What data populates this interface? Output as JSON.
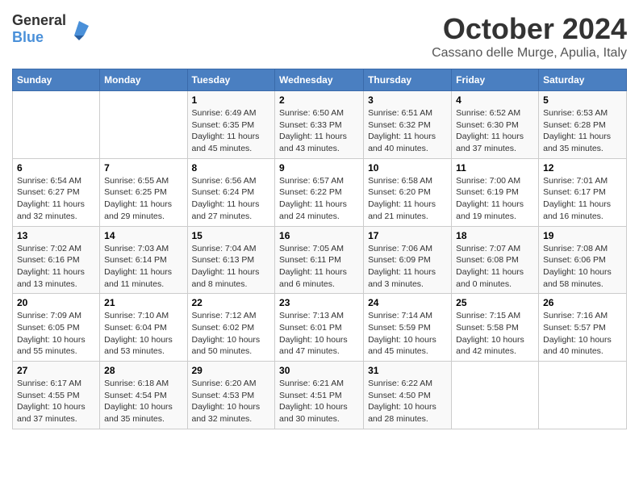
{
  "header": {
    "logo": {
      "text_general": "General",
      "text_blue": "Blue"
    },
    "month": "October 2024",
    "location": "Cassano delle Murge, Apulia, Italy"
  },
  "days_of_week": [
    "Sunday",
    "Monday",
    "Tuesday",
    "Wednesday",
    "Thursday",
    "Friday",
    "Saturday"
  ],
  "weeks": [
    [
      {
        "day": "",
        "info": ""
      },
      {
        "day": "",
        "info": ""
      },
      {
        "day": "1",
        "info": "Sunrise: 6:49 AM\nSunset: 6:35 PM\nDaylight: 11 hours and 45 minutes."
      },
      {
        "day": "2",
        "info": "Sunrise: 6:50 AM\nSunset: 6:33 PM\nDaylight: 11 hours and 43 minutes."
      },
      {
        "day": "3",
        "info": "Sunrise: 6:51 AM\nSunset: 6:32 PM\nDaylight: 11 hours and 40 minutes."
      },
      {
        "day": "4",
        "info": "Sunrise: 6:52 AM\nSunset: 6:30 PM\nDaylight: 11 hours and 37 minutes."
      },
      {
        "day": "5",
        "info": "Sunrise: 6:53 AM\nSunset: 6:28 PM\nDaylight: 11 hours and 35 minutes."
      }
    ],
    [
      {
        "day": "6",
        "info": "Sunrise: 6:54 AM\nSunset: 6:27 PM\nDaylight: 11 hours and 32 minutes."
      },
      {
        "day": "7",
        "info": "Sunrise: 6:55 AM\nSunset: 6:25 PM\nDaylight: 11 hours and 29 minutes."
      },
      {
        "day": "8",
        "info": "Sunrise: 6:56 AM\nSunset: 6:24 PM\nDaylight: 11 hours and 27 minutes."
      },
      {
        "day": "9",
        "info": "Sunrise: 6:57 AM\nSunset: 6:22 PM\nDaylight: 11 hours and 24 minutes."
      },
      {
        "day": "10",
        "info": "Sunrise: 6:58 AM\nSunset: 6:20 PM\nDaylight: 11 hours and 21 minutes."
      },
      {
        "day": "11",
        "info": "Sunrise: 7:00 AM\nSunset: 6:19 PM\nDaylight: 11 hours and 19 minutes."
      },
      {
        "day": "12",
        "info": "Sunrise: 7:01 AM\nSunset: 6:17 PM\nDaylight: 11 hours and 16 minutes."
      }
    ],
    [
      {
        "day": "13",
        "info": "Sunrise: 7:02 AM\nSunset: 6:16 PM\nDaylight: 11 hours and 13 minutes."
      },
      {
        "day": "14",
        "info": "Sunrise: 7:03 AM\nSunset: 6:14 PM\nDaylight: 11 hours and 11 minutes."
      },
      {
        "day": "15",
        "info": "Sunrise: 7:04 AM\nSunset: 6:13 PM\nDaylight: 11 hours and 8 minutes."
      },
      {
        "day": "16",
        "info": "Sunrise: 7:05 AM\nSunset: 6:11 PM\nDaylight: 11 hours and 6 minutes."
      },
      {
        "day": "17",
        "info": "Sunrise: 7:06 AM\nSunset: 6:09 PM\nDaylight: 11 hours and 3 minutes."
      },
      {
        "day": "18",
        "info": "Sunrise: 7:07 AM\nSunset: 6:08 PM\nDaylight: 11 hours and 0 minutes."
      },
      {
        "day": "19",
        "info": "Sunrise: 7:08 AM\nSunset: 6:06 PM\nDaylight: 10 hours and 58 minutes."
      }
    ],
    [
      {
        "day": "20",
        "info": "Sunrise: 7:09 AM\nSunset: 6:05 PM\nDaylight: 10 hours and 55 minutes."
      },
      {
        "day": "21",
        "info": "Sunrise: 7:10 AM\nSunset: 6:04 PM\nDaylight: 10 hours and 53 minutes."
      },
      {
        "day": "22",
        "info": "Sunrise: 7:12 AM\nSunset: 6:02 PM\nDaylight: 10 hours and 50 minutes."
      },
      {
        "day": "23",
        "info": "Sunrise: 7:13 AM\nSunset: 6:01 PM\nDaylight: 10 hours and 47 minutes."
      },
      {
        "day": "24",
        "info": "Sunrise: 7:14 AM\nSunset: 5:59 PM\nDaylight: 10 hours and 45 minutes."
      },
      {
        "day": "25",
        "info": "Sunrise: 7:15 AM\nSunset: 5:58 PM\nDaylight: 10 hours and 42 minutes."
      },
      {
        "day": "26",
        "info": "Sunrise: 7:16 AM\nSunset: 5:57 PM\nDaylight: 10 hours and 40 minutes."
      }
    ],
    [
      {
        "day": "27",
        "info": "Sunrise: 6:17 AM\nSunset: 4:55 PM\nDaylight: 10 hours and 37 minutes."
      },
      {
        "day": "28",
        "info": "Sunrise: 6:18 AM\nSunset: 4:54 PM\nDaylight: 10 hours and 35 minutes."
      },
      {
        "day": "29",
        "info": "Sunrise: 6:20 AM\nSunset: 4:53 PM\nDaylight: 10 hours and 32 minutes."
      },
      {
        "day": "30",
        "info": "Sunrise: 6:21 AM\nSunset: 4:51 PM\nDaylight: 10 hours and 30 minutes."
      },
      {
        "day": "31",
        "info": "Sunrise: 6:22 AM\nSunset: 4:50 PM\nDaylight: 10 hours and 28 minutes."
      },
      {
        "day": "",
        "info": ""
      },
      {
        "day": "",
        "info": ""
      }
    ]
  ]
}
